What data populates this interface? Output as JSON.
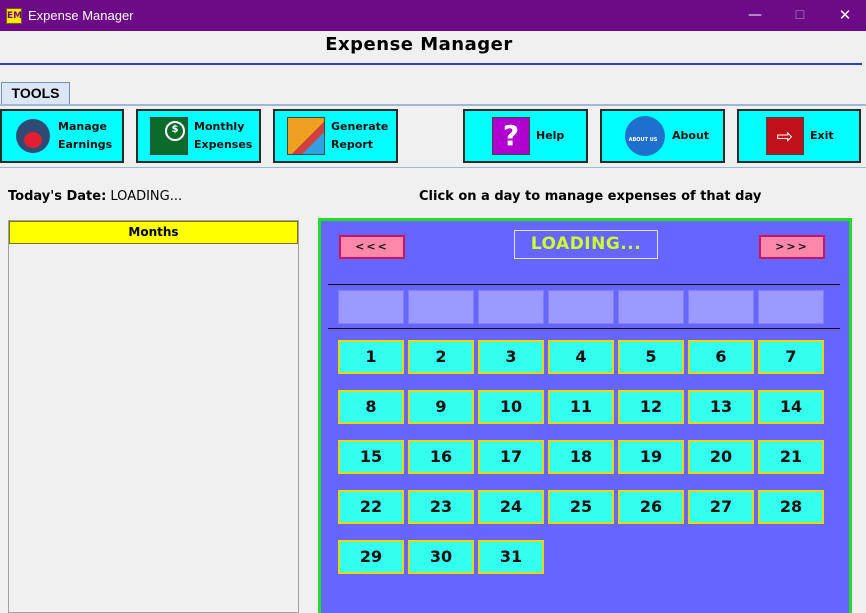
{
  "window": {
    "title": "Expense Manager",
    "icon_text": "EM",
    "controls": {
      "minimize": "—",
      "maximize": "☐",
      "close": "✕"
    }
  },
  "header": {
    "title": "Expense Manager"
  },
  "tabs": [
    {
      "label": "TOOLS",
      "selected": true
    }
  ],
  "toolbar": {
    "buttons": [
      {
        "id": "earn",
        "label": "Manage\nEarnings",
        "icon": "piggy-bank-icon"
      },
      {
        "id": "monthly",
        "label": "Monthly\nExpenses",
        "icon": "money-chart-icon"
      },
      {
        "id": "report",
        "label": "Generate\nReport",
        "icon": "report-chart-icon"
      },
      {
        "id": "help",
        "label": "Help",
        "icon": "question-mark-icon"
      },
      {
        "id": "about",
        "label": "About",
        "icon": "about-us-icon"
      },
      {
        "id": "exit",
        "label": "Exit",
        "icon": "exit-door-icon"
      }
    ]
  },
  "info": {
    "today_label": "Today's Date:",
    "today_value": "LOADING...",
    "hint": "Click on a day to manage expenses of that day"
  },
  "months": {
    "header": "Months",
    "items": []
  },
  "calendar": {
    "prev_label": "<<<",
    "next_label": ">>>",
    "month_label": "LOADING...",
    "weekdays": [
      "",
      "",
      "",
      "",
      "",
      "",
      ""
    ],
    "days": [
      "1",
      "2",
      "3",
      "4",
      "5",
      "6",
      "7",
      "8",
      "9",
      "10",
      "11",
      "12",
      "13",
      "14",
      "15",
      "16",
      "17",
      "18",
      "19",
      "20",
      "21",
      "22",
      "23",
      "24",
      "25",
      "26",
      "27",
      "28",
      "29",
      "30",
      "31"
    ]
  },
  "colors": {
    "titlebar": "#6d0a87",
    "tool_button": "#00ffff",
    "calendar_bg": "#6666ff",
    "calendar_border": "#22dd22",
    "day_cell": "#33ffee",
    "day_border": "#e8d800",
    "nav_button": "#ff88aa",
    "month_label": "#ccff33",
    "months_header": "#ffff00"
  }
}
